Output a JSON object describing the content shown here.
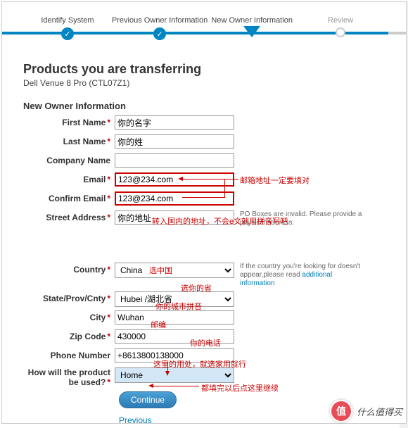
{
  "stepper": {
    "steps": [
      {
        "label": "Identify System",
        "state": "done"
      },
      {
        "label": "Previous Owner Information",
        "state": "done"
      },
      {
        "label": "New Owner Information",
        "state": "current"
      },
      {
        "label": "Review",
        "state": "future"
      }
    ]
  },
  "heading": "Products you are transferring",
  "subtitle": "Dell Venue 8 Pro (CTL07Z1)",
  "section_title": "New Owner Information",
  "fields": {
    "first_name": {
      "label": "First Name",
      "value": "你的名字",
      "required": true
    },
    "last_name": {
      "label": "Last Name",
      "value": "你的姓",
      "required": true
    },
    "company": {
      "label": "Company Name",
      "value": "",
      "required": false
    },
    "email": {
      "label": "Email",
      "value": "123@234.com",
      "required": true
    },
    "confirm_email": {
      "label": "Confirm Email",
      "value": "123@234.com",
      "required": true
    },
    "street": {
      "label": "Street Address",
      "value": "你的地址",
      "required": true,
      "hint": "PO Boxes are invalid. Please provide a physical address."
    },
    "country": {
      "label": "Country",
      "value": "China",
      "required": true,
      "hint_pre": "If the country you're looking for doesn't appear,please read",
      "hint_link": "additional information"
    },
    "state": {
      "label": "State/Prov/Cnty",
      "value": "Hubei /湖北省",
      "required": true
    },
    "city": {
      "label": "City",
      "value": "Wuhan",
      "required": true
    },
    "zip": {
      "label": "Zip Code",
      "value": "430000",
      "required": true
    },
    "phone": {
      "label": "Phone Number",
      "value": "+8613800138000",
      "required": false
    },
    "usage": {
      "label": "How will the product be used?",
      "value": "Home",
      "required": true
    }
  },
  "buttons": {
    "continue": "Continue",
    "previous": "Previous"
  },
  "annotations": {
    "a1": "邮箱地址一定要填对",
    "a2": "转入国内的地址，不会e文就用拼音写吧",
    "a3": "选中国",
    "a4": "选你的省",
    "a5": "你的城市拼音",
    "a6": "邮编",
    "a7": "你的电话",
    "a8": "这里的用处，就选家用就行",
    "a9": "都填完以后点这里继续"
  },
  "watermark": "什么值得买"
}
